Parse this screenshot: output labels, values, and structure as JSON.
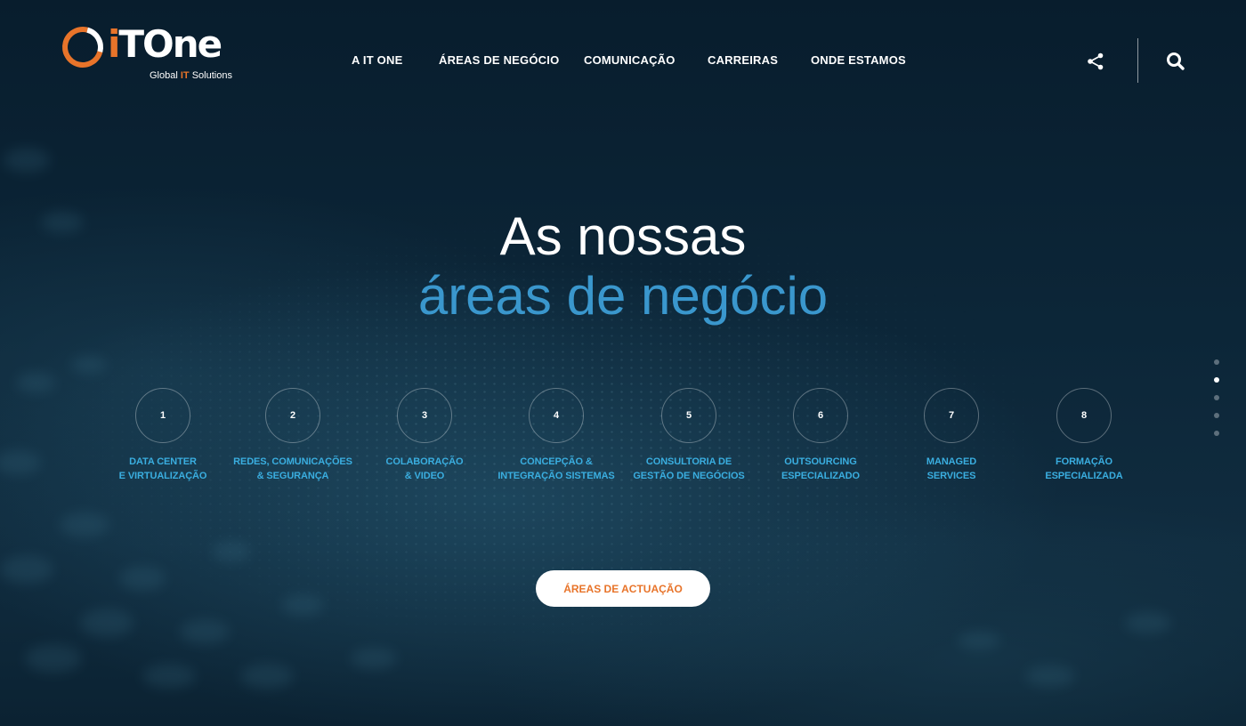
{
  "brand": {
    "name_i": "i",
    "name_rest": "TOne",
    "tagline_pre": "Global ",
    "tagline_acc": "IT",
    "tagline_post": " Solutions",
    "colors": {
      "orange": "#e8742a",
      "blue": "#3a97cd",
      "label_blue": "#3aaee0"
    }
  },
  "nav": {
    "items": [
      {
        "label": "A IT ONE"
      },
      {
        "label": "ÁREAS DE NEGÓCIO"
      },
      {
        "label": "COMUNICAÇÃO"
      },
      {
        "label": "CARREIRAS"
      },
      {
        "label": "ONDE ESTAMOS"
      }
    ],
    "share_icon": "share-icon",
    "search_icon": "search-icon"
  },
  "hero": {
    "line1": "As nossas",
    "line2": "áreas de negócio"
  },
  "areas": [
    {
      "number": "1",
      "line1": "DATA CENTER",
      "line2": "E VIRTUALIZAÇÃO"
    },
    {
      "number": "2",
      "line1": "REDES, COMUNICAÇÕES",
      "line2": "& SEGURANÇA"
    },
    {
      "number": "3",
      "line1": "COLABORAÇÃO",
      "line2": "& VIDEO"
    },
    {
      "number": "4",
      "line1": "CONCEPÇÃO &",
      "line2": "INTEGRAÇÃO SISTEMAS"
    },
    {
      "number": "5",
      "line1": "CONSULTORIA DE",
      "line2": "GESTÃO DE NEGÓCIOS"
    },
    {
      "number": "6",
      "line1": "OUTSOURCING",
      "line2": "ESPECIALIZADO"
    },
    {
      "number": "7",
      "line1": "MANAGED",
      "line2": "SERVICES"
    },
    {
      "number": "8",
      "line1": "FORMAÇÃO",
      "line2": "ESPECIALIZADA"
    }
  ],
  "cta": {
    "label": "ÁREAS DE ACTUAÇÃO"
  },
  "pager": {
    "total": 5,
    "active": 2
  }
}
